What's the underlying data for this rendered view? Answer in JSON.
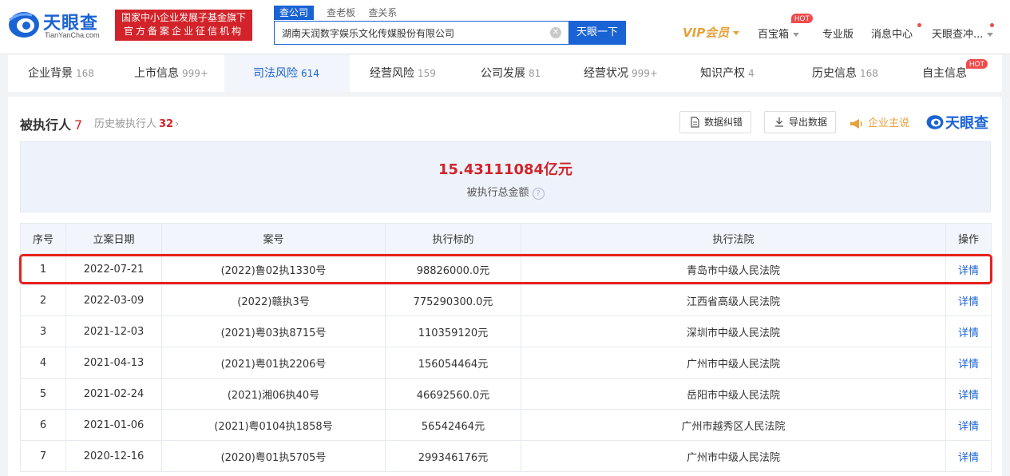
{
  "brand": {
    "name": "天眼查",
    "domain": "TianYanCha.com",
    "primary_color": "#1a63d4"
  },
  "badge": {
    "line1": "国家中小企业发展子基金旗下",
    "line2": "官方备案企业征信机构",
    "color": "#d2232a"
  },
  "search": {
    "tabs": [
      "查公司",
      "查老板",
      "查关系"
    ],
    "query": "湖南天润数字娱乐文化传媒股份有限公司",
    "button": "天眼一下"
  },
  "topnav": {
    "vip": "VIP会员",
    "baibao": "百宝箱",
    "pro": "专业版",
    "messages": "消息中心",
    "user": "天眼查冲...",
    "hot": "HOT"
  },
  "tabs": [
    {
      "label": "企业背景",
      "count": "168"
    },
    {
      "label": "上市信息",
      "count": "999+"
    },
    {
      "label": "司法风险",
      "count": "614"
    },
    {
      "label": "经营风险",
      "count": "159"
    },
    {
      "label": "公司发展",
      "count": "81"
    },
    {
      "label": "经营状况",
      "count": "999+"
    },
    {
      "label": "知识产权",
      "count": "4"
    },
    {
      "label": "历史信息",
      "count": "168"
    },
    {
      "label": "自主信息",
      "count": ""
    }
  ],
  "section": {
    "title": "被执行人",
    "count": "7",
    "history_label": "历史被执行人",
    "history_count": "32",
    "btn_correct": "数据纠错",
    "btn_export": "导出数据",
    "promo": "企业主说",
    "brand_small": "天眼查"
  },
  "summary": {
    "total": "15.43111084亿元",
    "label": "被执行总金额"
  },
  "table": {
    "headers": [
      "序号",
      "立案日期",
      "案号",
      "执行标的",
      "执行法院",
      "操作"
    ],
    "rows": [
      [
        "1",
        "2022-07-21",
        "(2022)鲁02执1330号",
        "98826000.0元",
        "青岛市中级人民法院",
        "详情"
      ],
      [
        "2",
        "2022-03-09",
        "(2022)赣执3号",
        "775290300.0元",
        "江西省高级人民法院",
        "详情"
      ],
      [
        "3",
        "2021-12-03",
        "(2021)粤03执8715号",
        "110359120元",
        "深圳市中级人民法院",
        "详情"
      ],
      [
        "4",
        "2021-04-13",
        "(2021)粤01执2206号",
        "156054464元",
        "广州市中级人民法院",
        "详情"
      ],
      [
        "5",
        "2021-02-24",
        "(2021)湘06执40号",
        "46692560.0元",
        "岳阳市中级人民法院",
        "详情"
      ],
      [
        "6",
        "2021-01-06",
        "(2021)粤0104执1858号",
        "56542464元",
        "广州市越秀区人民法院",
        "详情"
      ],
      [
        "7",
        "2020-12-16",
        "(2020)粤01执5705号",
        "299346176元",
        "广州市中级人民法院",
        "详情"
      ]
    ]
  }
}
